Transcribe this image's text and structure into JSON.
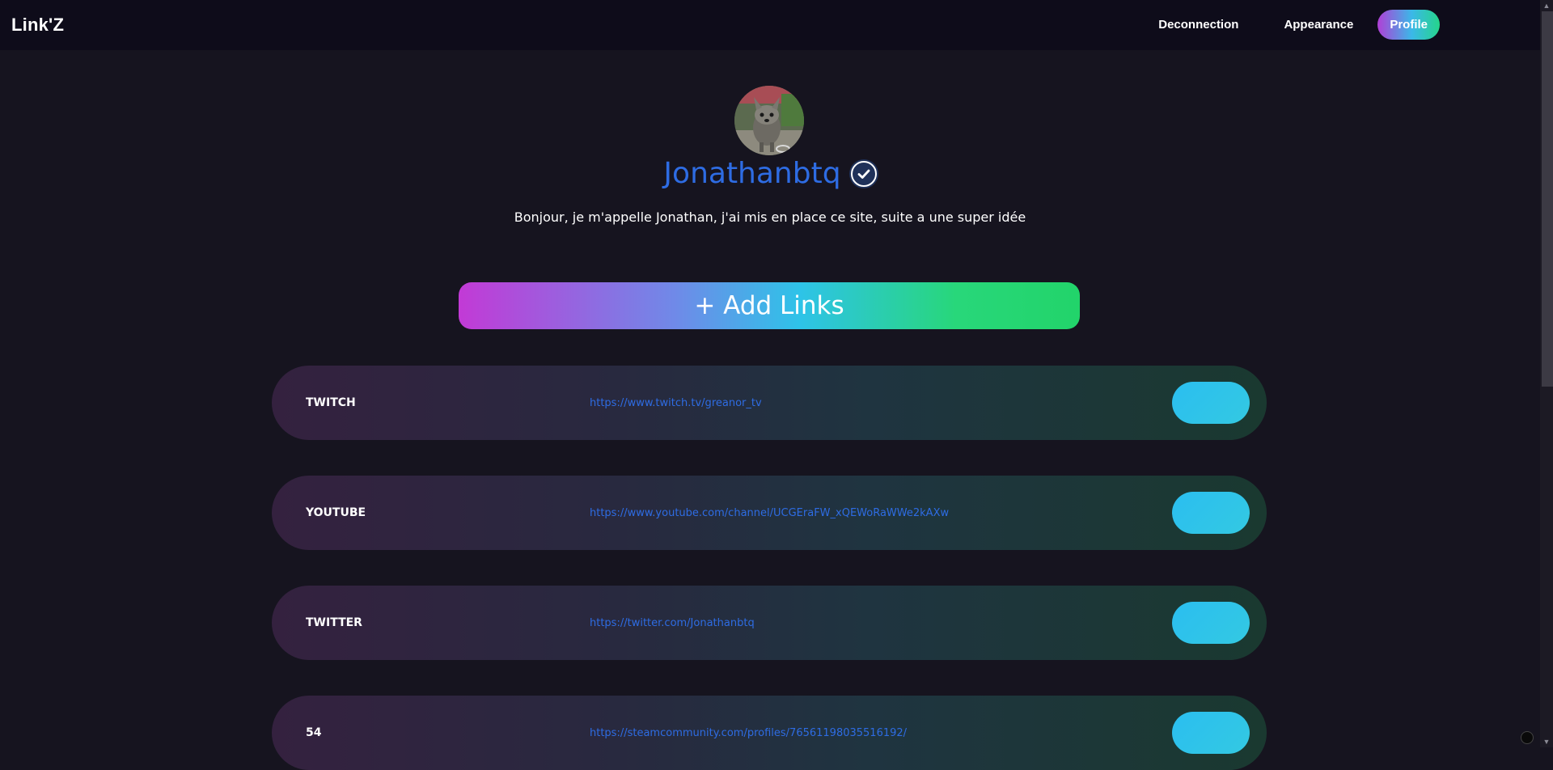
{
  "navbar": {
    "brand": "Link'Z",
    "links": {
      "deconnection": "Deconnection",
      "appearance": "Appearance",
      "profile": "Profile"
    }
  },
  "profile": {
    "username": "Jonathanbtq",
    "verified": true,
    "bio": "Bonjour, je m'appelle Jonathan, j'ai mis en place ce site, suite a une super idée"
  },
  "add_links_label": "+ Add Links",
  "links": [
    {
      "name": "TWITCH",
      "url": "https://www.twitch.tv/greanor_tv"
    },
    {
      "name": "YOUTUBE",
      "url": "https://www.youtube.com/channel/UCGEraFW_xQEWoRaWWe2kAXw"
    },
    {
      "name": "TWITTER",
      "url": "https://twitter.com/Jonathanbtq"
    },
    {
      "name": "54",
      "url": "https://steamcommunity.com/profiles/76561198035516192/"
    }
  ],
  "colors": {
    "background": "#16141f",
    "navbar": "#0e0c1a",
    "accent_blue": "#2e6ce3",
    "toggle": "#2bbef0"
  }
}
